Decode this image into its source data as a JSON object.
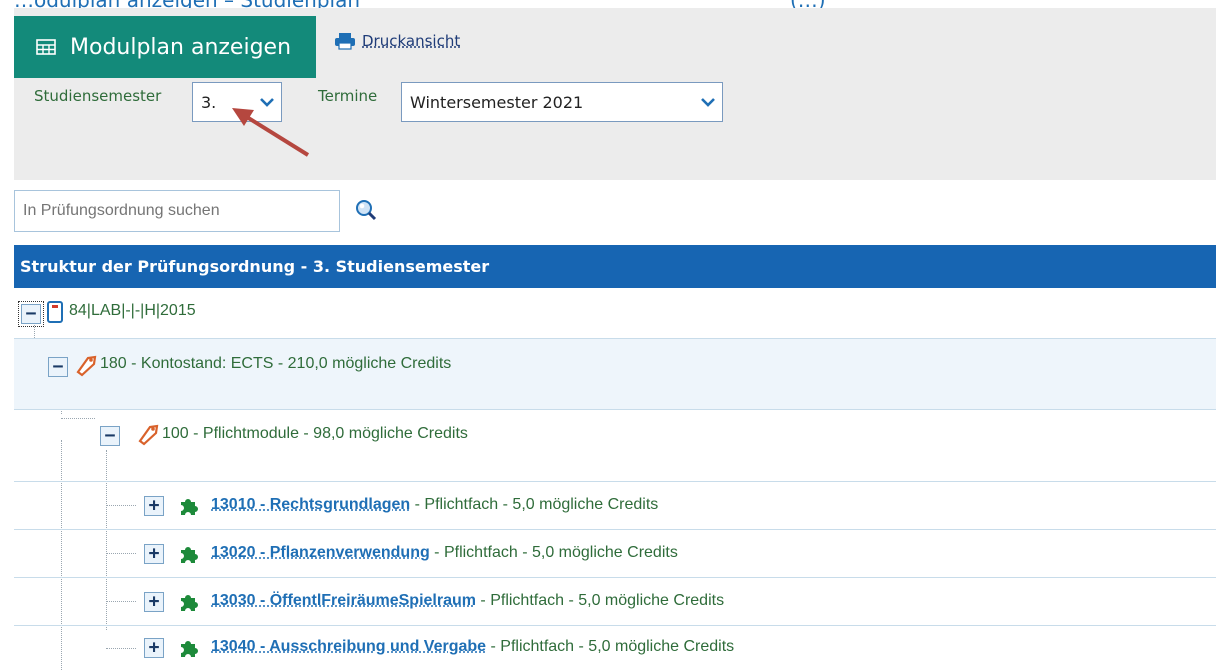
{
  "header_fragment": {
    "left": "…odulplan anzeigen – Studienplan",
    "right": "(…)"
  },
  "toolbar": {
    "modulplan_label": "Modulplan anzeigen",
    "druck_label": "Druckansicht",
    "semester_label": "Studiensemester",
    "semester_value": "3.",
    "termine_label": "Termine",
    "termine_value": "Wintersemester 2021"
  },
  "search": {
    "placeholder": "In Prüfungsordnung suchen"
  },
  "tree": {
    "title": "Struktur der Prüfungsordnung - 3. Studiensemester",
    "root": {
      "toggle": "−",
      "text": "84|LAB|-|-|H|2015"
    },
    "level1": {
      "toggle": "−",
      "text": "180 - Kontostand: ECTS - 210,0 mögliche Credits"
    },
    "level2": {
      "toggle": "−",
      "text": "100 - Pflichtmodule - 98,0 mögliche Credits"
    },
    "modules": [
      {
        "toggle": "+",
        "link": "13010 - Rechtsgrundlagen",
        "rest": " - Pflichtfach - 5,0 mögliche Credits"
      },
      {
        "toggle": "+",
        "link": "13020 - Pflanzenverwendung",
        "rest": " - Pflichtfach - 5,0 mögliche Credits"
      },
      {
        "toggle": "+",
        "link": "13030 - ÖffentlFreiräumeSpielraum",
        "rest": " - Pflichtfach - 5,0 mögliche Credits"
      },
      {
        "toggle": "+",
        "link": "13040 - Ausschreibung und Vergabe",
        "rest": " - Pflichtfach - 5,0 mögliche Credits"
      }
    ]
  },
  "colors": {
    "accent": "#138a7a",
    "header_blue": "#1765b2",
    "arrow": "#b5473f"
  }
}
